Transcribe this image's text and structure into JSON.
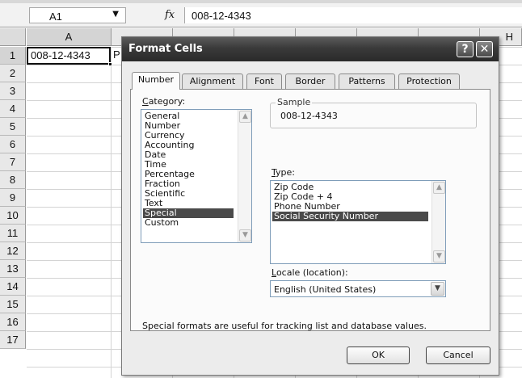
{
  "formula_bar": {
    "name_box": "A1",
    "fx_label": "fx",
    "formula": "008-12-4343"
  },
  "sheet": {
    "columns": [
      "A",
      "",
      "",
      "",
      "",
      "",
      "",
      "H"
    ],
    "rows": [
      "1",
      "2",
      "3",
      "4",
      "5",
      "6",
      "7",
      "8",
      "9",
      "10",
      "11",
      "12",
      "13",
      "14",
      "15",
      "16",
      "17"
    ],
    "cell_a1": "008-12-4343",
    "cell_b1_partial": "P"
  },
  "dialog": {
    "title": "Format Cells",
    "help_button": "?",
    "close_button": "✕",
    "tabs": [
      {
        "label": "Number",
        "selected": true
      },
      {
        "label": "Alignment",
        "selected": false
      },
      {
        "label": "Font",
        "selected": false
      },
      {
        "label": "Border",
        "selected": false
      },
      {
        "label": "Patterns",
        "selected": false
      },
      {
        "label": "Protection",
        "selected": false
      }
    ],
    "category": {
      "label_key": "C",
      "label_rest": "ategory:",
      "items": [
        "General",
        "Number",
        "Currency",
        "Accounting",
        "Date",
        "Time",
        "Percentage",
        "Fraction",
        "Scientific",
        "Text",
        "Special",
        "Custom"
      ],
      "selected": "Special"
    },
    "sample": {
      "legend": "Sample",
      "value": "008-12-4343"
    },
    "type": {
      "label_key": "T",
      "label_rest": "ype:",
      "items": [
        "Zip Code",
        "Zip Code + 4",
        "Phone Number",
        "Social Security Number"
      ],
      "selected": "Social Security Number"
    },
    "locale": {
      "label_key": "L",
      "label_rest": "ocale (location):",
      "value": "English (United States)"
    },
    "description": "Special formats are useful for tracking list and database values.",
    "ok_label": "OK",
    "cancel_label": "Cancel"
  },
  "colors": {
    "selection": "#4a4a4a",
    "titlebar": "#3a3a3a",
    "dialog_bg": "#ececec"
  }
}
